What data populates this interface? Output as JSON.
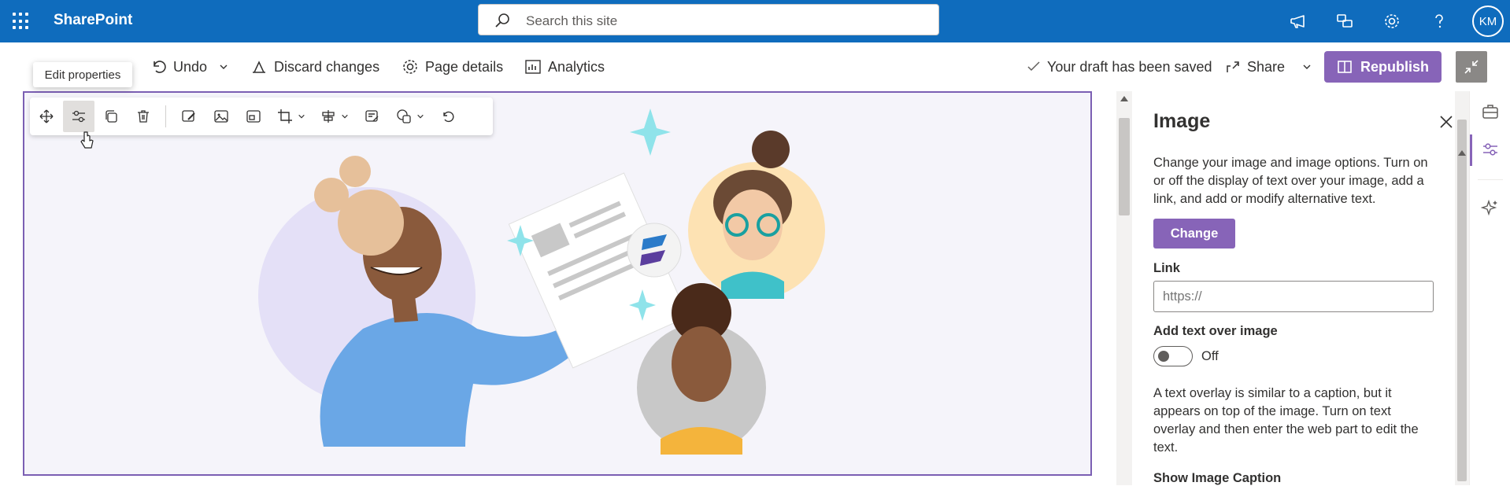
{
  "suite": {
    "app_name": "SharePoint",
    "search_placeholder": "Search this site",
    "avatar_initials": "KM"
  },
  "commandbar": {
    "undo": "Undo",
    "discard": "Discard changes",
    "page_details": "Page details",
    "analytics": "Analytics",
    "draft_status": "Your draft has been saved",
    "share": "Share",
    "republish": "Republish"
  },
  "tooltip": "Edit properties",
  "panel": {
    "title": "Image",
    "description": "Change your image and image options. Turn on or off the display of text over your image, add a link, and add or modify alternative text.",
    "change_button": "Change",
    "link_label": "Link",
    "link_placeholder": "https://",
    "text_over_label": "Add text over image",
    "toggle_state": "Off",
    "overlay_description": "A text overlay is similar to a caption, but it appears on top of the image. Turn on text overlay and then enter the web part to edit the text.",
    "caption_label": "Show Image Caption"
  },
  "colors": {
    "suite_bar": "#0f6cbd",
    "accent": "#8764b8",
    "frame": "#7b5fb3"
  }
}
